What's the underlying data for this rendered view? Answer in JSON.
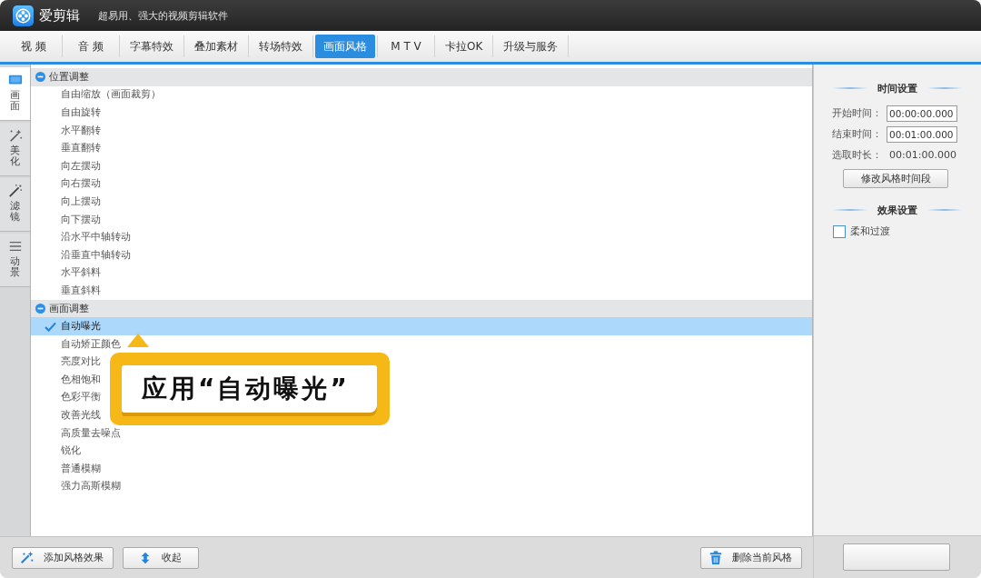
{
  "window": {
    "title": "爱剪辑",
    "subtitle": "超易用、强大的视频剪辑软件"
  },
  "tabs": [
    {
      "label": "视 频",
      "selected": false
    },
    {
      "label": "音 频",
      "selected": false
    },
    {
      "label": "字幕特效",
      "selected": false
    },
    {
      "label": "叠加素材",
      "selected": false
    },
    {
      "label": "转场特效",
      "selected": false
    },
    {
      "label": "画面风格",
      "selected": true
    },
    {
      "label": "M T V",
      "selected": false
    },
    {
      "label": "卡拉OK",
      "selected": false
    },
    {
      "label": "升级与服务",
      "selected": false
    }
  ],
  "side_tabs": [
    {
      "label": "画面",
      "selected": true
    },
    {
      "label": "美化",
      "selected": false
    },
    {
      "label": "滤镜",
      "selected": false
    },
    {
      "label": "动景",
      "selected": false
    }
  ],
  "groups": [
    {
      "title": "位置调整",
      "expanded": true,
      "items": [
        {
          "label": "自由缩放（画面裁剪）",
          "selected": false
        },
        {
          "label": "自由旋转",
          "selected": false
        },
        {
          "label": "水平翻转",
          "selected": false
        },
        {
          "label": "垂直翻转",
          "selected": false
        },
        {
          "label": "向左摆动",
          "selected": false
        },
        {
          "label": "向右摆动",
          "selected": false
        },
        {
          "label": "向上摆动",
          "selected": false
        },
        {
          "label": "向下摆动",
          "selected": false
        },
        {
          "label": "沿水平中轴转动",
          "selected": false
        },
        {
          "label": "沿垂直中轴转动",
          "selected": false
        },
        {
          "label": "水平斜料",
          "selected": false
        },
        {
          "label": "垂直斜料",
          "selected": false
        }
      ]
    },
    {
      "title": "画面调整",
      "expanded": true,
      "items": [
        {
          "label": "自动曝光",
          "selected": true
        },
        {
          "label": "自动矫正颜色",
          "selected": false
        },
        {
          "label": "亮度对比",
          "selected": false
        },
        {
          "label": "色相饱和",
          "selected": false
        },
        {
          "label": "色彩平衡",
          "selected": false
        },
        {
          "label": "改善光线",
          "selected": false
        },
        {
          "label": "高质量去噪点",
          "selected": false
        },
        {
          "label": "锐化",
          "selected": false
        },
        {
          "label": "普通模糊",
          "selected": false
        },
        {
          "label": "强力高斯模糊",
          "selected": false
        }
      ]
    }
  ],
  "callout": {
    "text": "应用“自动曝光”"
  },
  "time_settings": {
    "title": "时间设置",
    "fields": [
      {
        "label": "开始时间：",
        "value": "00:00:00.000"
      },
      {
        "label": "结束时间：",
        "value": "00:01:00.000"
      }
    ],
    "duration": {
      "label": "选取时长：",
      "value": "00:01:00.000"
    },
    "button": "修改风格时间段"
  },
  "effect_settings": {
    "title": "效果设置",
    "options": [
      {
        "label": "柔和过渡",
        "checked": false
      }
    ]
  },
  "bottom_bar": {
    "left_buttons": [
      "添加风格效果",
      "收起"
    ],
    "right_buttons": [
      "删除当前风格"
    ]
  }
}
